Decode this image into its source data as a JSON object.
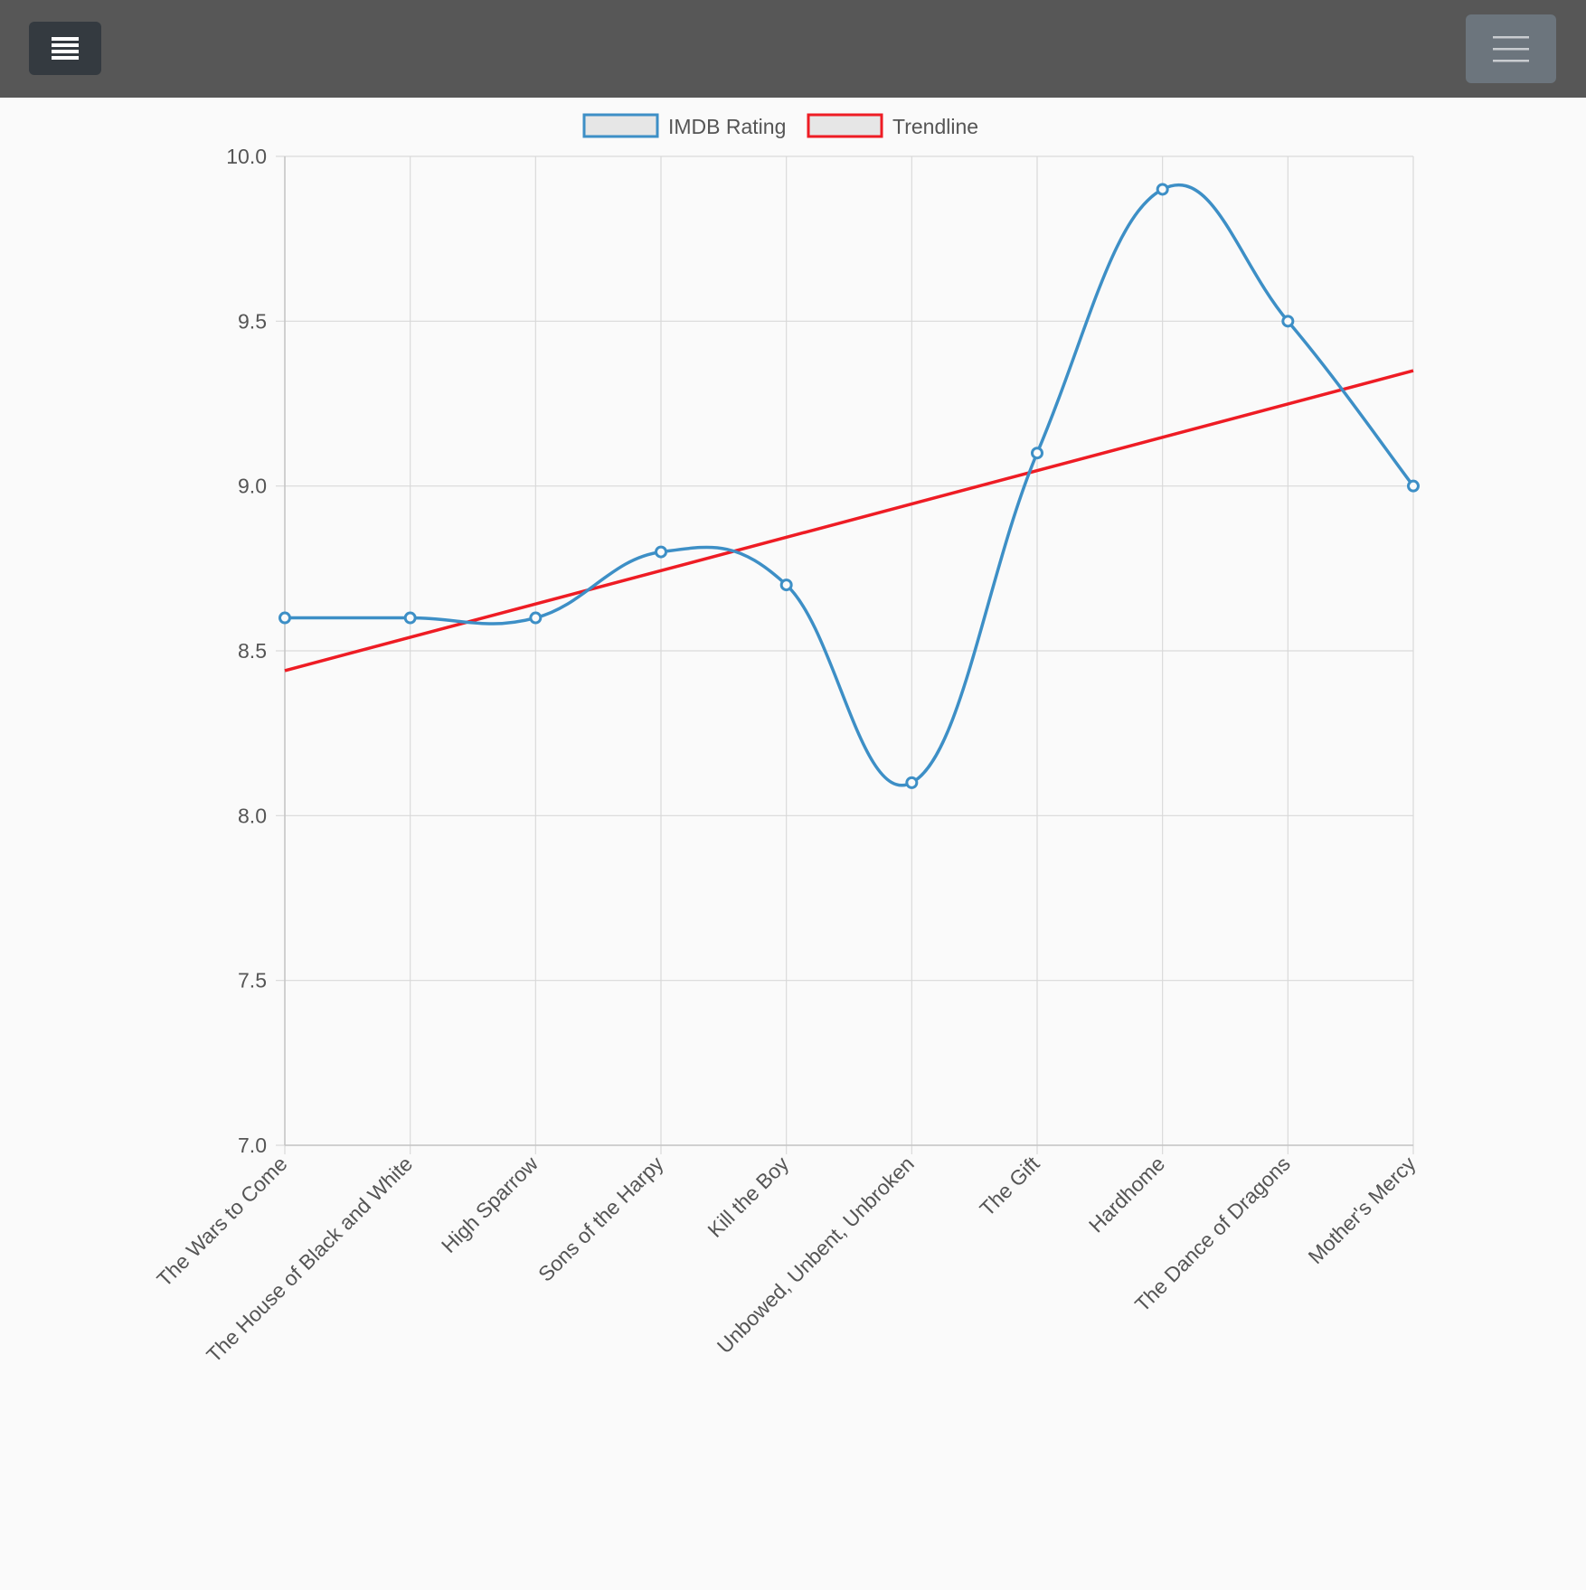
{
  "topbar": {
    "menu_button_icon": "list-icon",
    "navbar_toggler_icon": "hamburger-icon"
  },
  "colors": {
    "series_rating": "#3d8fc6",
    "series_trend": "#ee1c24",
    "legend_fill": "#e6e6e6",
    "grid": "#d9d9d9",
    "tick_text": "#555555"
  },
  "chart_data": {
    "type": "line",
    "categories": [
      "The Wars to Come",
      "The House of Black and White",
      "High Sparrow",
      "Sons of the Harpy",
      "Kill the Boy",
      "Unbowed, Unbent, Unbroken",
      "The Gift",
      "Hardhome",
      "The Dance of Dragons",
      "Mother's Mercy"
    ],
    "series": [
      {
        "name": "IMDB Rating",
        "values": [
          8.6,
          8.6,
          8.6,
          8.8,
          8.7,
          8.1,
          9.1,
          9.9,
          9.5,
          9.0
        ],
        "smooth": true,
        "points": true
      },
      {
        "name": "Trendline",
        "values": [
          8.44,
          8.54,
          8.64,
          8.74,
          8.84,
          8.94,
          9.05,
          9.15,
          9.25,
          9.35
        ],
        "smooth": false,
        "points": false
      }
    ],
    "y_ticks": [
      "10.0",
      "9.5",
      "9.0",
      "8.5",
      "8.0",
      "7.5",
      "7.0"
    ],
    "ylim": [
      7.0,
      10.0
    ],
    "grid": true,
    "legend_position": "top-center"
  }
}
